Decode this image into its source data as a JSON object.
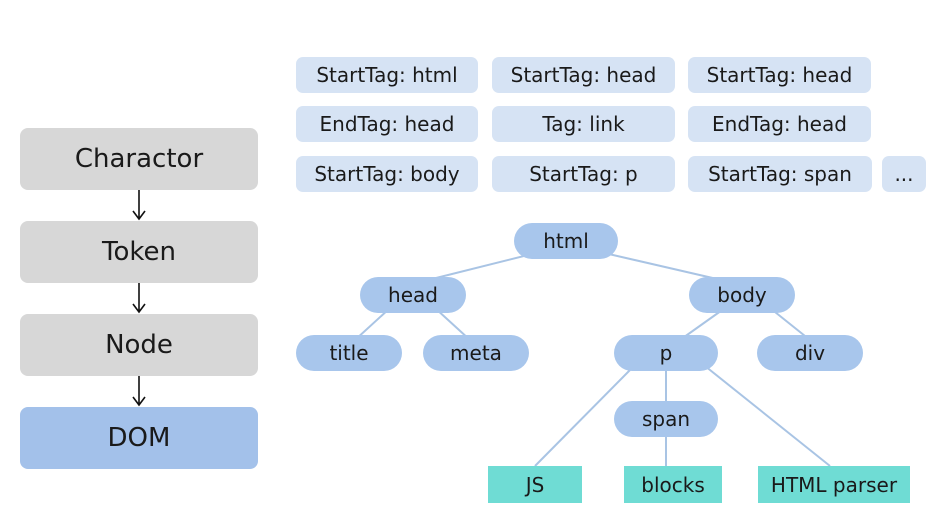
{
  "stages": [
    "Charactor",
    "Token",
    "Node",
    "DOM"
  ],
  "tokens": [
    [
      "StartTag: html",
      "StartTag: head",
      "StartTag: head"
    ],
    [
      "EndTag: head",
      "Tag: link",
      "EndTag: head"
    ],
    [
      "StartTag: body",
      "StartTag: p",
      "StartTag: span",
      "..."
    ]
  ],
  "tree": {
    "html": "html",
    "head": "head",
    "body": "body",
    "title": "title",
    "meta": "meta",
    "p": "p",
    "div": "div",
    "span": "span",
    "js": "JS",
    "blocks": "blocks",
    "parser": "HTML parser"
  },
  "colors": {
    "stage": "#d7d7d7",
    "dom": "#a3c1ea",
    "token": "#d6e3f4",
    "node": "#a8c6ec",
    "leaf": "#6fdcd4",
    "edge": "#a9c4e4"
  }
}
